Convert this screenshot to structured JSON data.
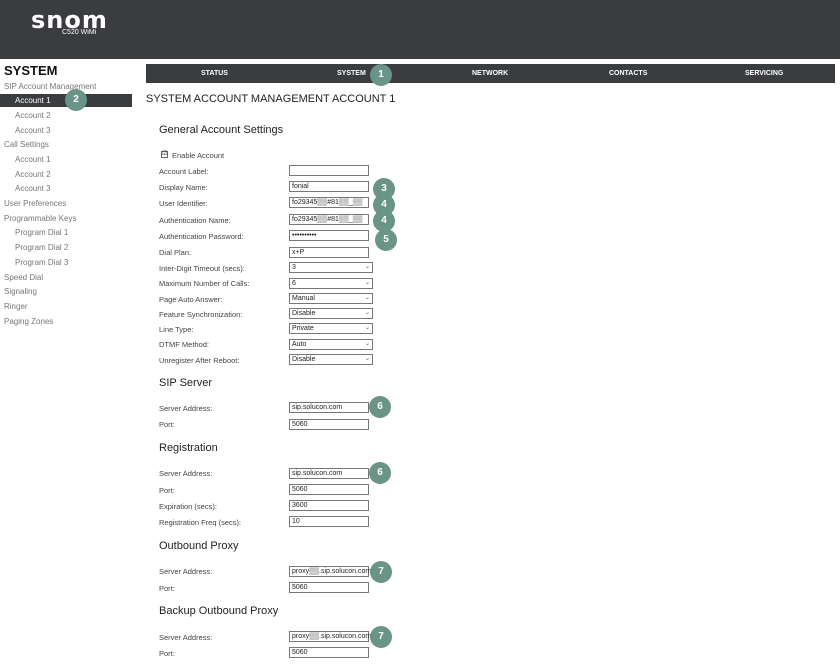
{
  "header": {
    "logo": "snom",
    "model": "C520 WiMi"
  },
  "sidebar": {
    "title": "SYSTEM",
    "items": [
      {
        "label": "SIP Account Management"
      },
      {
        "label": "Account 1"
      },
      {
        "label": "Account 2"
      },
      {
        "label": "Account 3"
      },
      {
        "label": "Call Settings"
      },
      {
        "label": "Account 1"
      },
      {
        "label": "Account 2"
      },
      {
        "label": "Account 3"
      },
      {
        "label": "User Preferences"
      },
      {
        "label": "Programmable Keys"
      },
      {
        "label": "Program Dial 1"
      },
      {
        "label": "Program Dial 2"
      },
      {
        "label": "Program Dial 3"
      },
      {
        "label": "Speed Dial"
      },
      {
        "label": "Signaling"
      },
      {
        "label": "Ringer"
      },
      {
        "label": "Paging Zones"
      }
    ]
  },
  "nav": {
    "status": "STATUS",
    "system": "SYSTEM",
    "network": "NETWORK",
    "contacts": "CONTACTS",
    "servicing": "SERVICING"
  },
  "page_title": "SYSTEM ACCOUNT MANAGEMENT ACCOUNT 1",
  "general": {
    "title": "General Account Settings",
    "enable_account": "Enable Account",
    "enable_checked": "☑",
    "account_label": {
      "label": "Account Label:",
      "value": ""
    },
    "display_name": {
      "label": "Display Name:",
      "value": "fonial"
    },
    "user_identifier": {
      "label": "User Identifier:",
      "value": "fo29345▒▒#81▒▒_▒▒"
    },
    "auth_name": {
      "label": "Authentication Name:",
      "value": "fo29345▒▒#81▒▒_▒▒"
    },
    "auth_password": {
      "label": "Authentication Password:",
      "value": "••••••••••"
    },
    "dial_plan": {
      "label": "Dial Plan:",
      "value": "x+P"
    },
    "inter_digit": {
      "label": "Inter-Digit Timeout (secs):",
      "value": "3"
    },
    "max_calls": {
      "label": "Maximum Number of Calls:",
      "value": "6"
    },
    "page_auto": {
      "label": "Page Auto Answer:",
      "value": "Manual"
    },
    "feature_sync": {
      "label": "Feature Synchronization:",
      "value": "Disable"
    },
    "line_type": {
      "label": "Line Type:",
      "value": "Private"
    },
    "dtmf": {
      "label": "DTMF Method:",
      "value": "Auto"
    },
    "unregister": {
      "label": "Unregister After Reboot:",
      "value": "Disable"
    }
  },
  "sip_server": {
    "title": "SIP Server",
    "address": {
      "label": "Server Address:",
      "value": "sip.solucon.com"
    },
    "port": {
      "label": "Port:",
      "value": "5060"
    }
  },
  "registration": {
    "title": "Registration",
    "address": {
      "label": "Server Address:",
      "value": "sip.solucon.com"
    },
    "port": {
      "label": "Port:",
      "value": "5060"
    },
    "expiration": {
      "label": "Expiration (secs):",
      "value": "3600"
    },
    "freq": {
      "label": "Registration Freq (secs):",
      "value": "10"
    }
  },
  "outbound_proxy": {
    "title": "Outbound Proxy",
    "address": {
      "label": "Server Address:",
      "value": "proxy▒▒.sip.solucon.com"
    },
    "port": {
      "label": "Port:",
      "value": "5060"
    }
  },
  "backup_proxy": {
    "title": "Backup Outbound Proxy",
    "address": {
      "label": "Server Address:",
      "value": "proxy▒▒.sip.solucon.com"
    },
    "port": {
      "label": "Port:",
      "value": "5060"
    }
  },
  "badges": [
    "1",
    "2",
    "3",
    "4",
    "4",
    "5",
    "6",
    "6",
    "7",
    "7"
  ],
  "colors": {
    "header": "#3a3c40",
    "badge": "#6b9488"
  }
}
